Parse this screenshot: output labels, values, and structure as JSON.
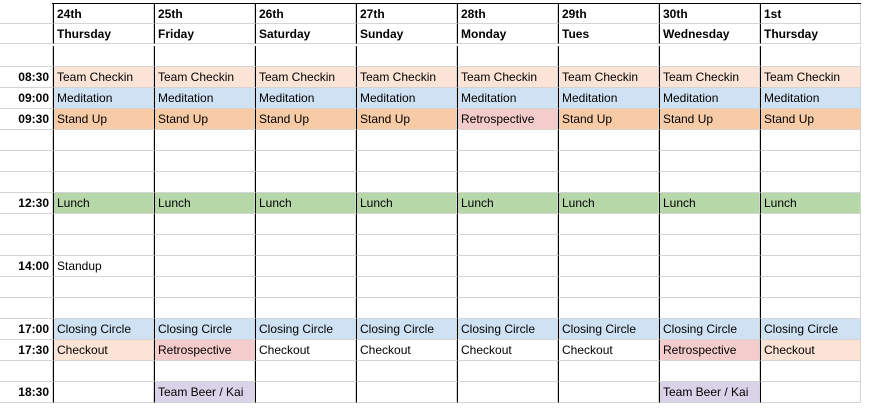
{
  "colors": {
    "peach": "#fbe4d5",
    "blue": "#cfe2f3",
    "orange": "#f8cba7",
    "pink": "#f4cccc",
    "green": "#b6d7a8",
    "lavender": "#d9d2e9",
    "white": "#ffffff"
  },
  "days": [
    {
      "date": "24th",
      "weekday": "Thursday"
    },
    {
      "date": "25th",
      "weekday": "Friday"
    },
    {
      "date": "26th",
      "weekday": "Saturday"
    },
    {
      "date": "27th",
      "weekday": "Sunday"
    },
    {
      "date": "28th",
      "weekday": "Monday"
    },
    {
      "date": "29th",
      "weekday": "Tues"
    },
    {
      "date": "30th",
      "weekday": "Wednesday"
    },
    {
      "date": "1st",
      "weekday": "Thursday"
    }
  ],
  "rows": [
    {
      "time": "",
      "cells": [],
      "spacer": true
    },
    {
      "time": "08:30",
      "cells": [
        {
          "text": "Team Checkin",
          "color": "peach"
        },
        {
          "text": "Team Checkin",
          "color": "peach"
        },
        {
          "text": "Team Checkin",
          "color": "peach"
        },
        {
          "text": "Team Checkin",
          "color": "peach"
        },
        {
          "text": "Team Checkin",
          "color": "peach"
        },
        {
          "text": "Team Checkin",
          "color": "peach"
        },
        {
          "text": "Team Checkin",
          "color": "peach"
        },
        {
          "text": "Team Checkin",
          "color": "peach"
        }
      ]
    },
    {
      "time": "09:00",
      "cells": [
        {
          "text": "Meditation",
          "color": "blue"
        },
        {
          "text": "Meditation",
          "color": "blue"
        },
        {
          "text": "Meditation",
          "color": "blue"
        },
        {
          "text": "Meditation",
          "color": "blue"
        },
        {
          "text": "Meditation",
          "color": "blue"
        },
        {
          "text": "Meditation",
          "color": "blue"
        },
        {
          "text": "Meditation",
          "color": "blue"
        },
        {
          "text": "Meditation",
          "color": "blue"
        }
      ]
    },
    {
      "time": "09:30",
      "cells": [
        {
          "text": "Stand Up",
          "color": "orange"
        },
        {
          "text": "Stand Up",
          "color": "orange"
        },
        {
          "text": "Stand Up",
          "color": "orange"
        },
        {
          "text": "Stand Up",
          "color": "orange"
        },
        {
          "text": "Retrospective",
          "color": "pink"
        },
        {
          "text": "Stand Up",
          "color": "orange"
        },
        {
          "text": "Stand Up",
          "color": "orange"
        },
        {
          "text": "Stand Up",
          "color": "orange"
        }
      ]
    },
    {
      "time": "",
      "cells": []
    },
    {
      "time": "",
      "cells": []
    },
    {
      "time": "",
      "cells": []
    },
    {
      "time": "12:30",
      "cells": [
        {
          "text": "Lunch",
          "color": "green"
        },
        {
          "text": "Lunch",
          "color": "green"
        },
        {
          "text": "Lunch",
          "color": "green"
        },
        {
          "text": "Lunch",
          "color": "green"
        },
        {
          "text": "Lunch",
          "color": "green"
        },
        {
          "text": "Lunch",
          "color": "green"
        },
        {
          "text": "Lunch",
          "color": "green"
        },
        {
          "text": "Lunch",
          "color": "green"
        }
      ]
    },
    {
      "time": "",
      "cells": []
    },
    {
      "time": "",
      "cells": []
    },
    {
      "time": "14:00",
      "cells": [
        {
          "text": "Standup",
          "color": "white"
        },
        {
          "text": "",
          "color": "white"
        },
        {
          "text": "",
          "color": "white"
        },
        {
          "text": "",
          "color": "white"
        },
        {
          "text": "",
          "color": "white"
        },
        {
          "text": "",
          "color": "white"
        },
        {
          "text": "",
          "color": "white"
        },
        {
          "text": "",
          "color": "white"
        }
      ]
    },
    {
      "time": "",
      "cells": []
    },
    {
      "time": "",
      "cells": []
    },
    {
      "time": "17:00",
      "cells": [
        {
          "text": "Closing Circle",
          "color": "blue"
        },
        {
          "text": "Closing Circle",
          "color": "blue"
        },
        {
          "text": "Closing Circle",
          "color": "blue"
        },
        {
          "text": "Closing Circle",
          "color": "blue"
        },
        {
          "text": "Closing Circle",
          "color": "blue"
        },
        {
          "text": "Closing Circle",
          "color": "blue"
        },
        {
          "text": "Closing Circle",
          "color": "blue"
        },
        {
          "text": "Closing Circle",
          "color": "blue"
        }
      ]
    },
    {
      "time": "17:30",
      "cells": [
        {
          "text": "Checkout",
          "color": "peach"
        },
        {
          "text": "Retrospective",
          "color": "pink"
        },
        {
          "text": "Checkout",
          "color": "white"
        },
        {
          "text": "Checkout",
          "color": "white"
        },
        {
          "text": "Checkout",
          "color": "white"
        },
        {
          "text": "Checkout",
          "color": "white"
        },
        {
          "text": "Retrospective",
          "color": "pink"
        },
        {
          "text": "Checkout",
          "color": "peach"
        }
      ]
    },
    {
      "time": "",
      "cells": []
    },
    {
      "time": "18:30",
      "cells": [
        {
          "text": "",
          "color": "white"
        },
        {
          "text": "Team Beer / Kai",
          "color": "lavender"
        },
        {
          "text": "",
          "color": "white"
        },
        {
          "text": "",
          "color": "white"
        },
        {
          "text": "",
          "color": "white"
        },
        {
          "text": "",
          "color": "white"
        },
        {
          "text": "Team Beer / Kai",
          "color": "lavender"
        },
        {
          "text": "",
          "color": "white"
        }
      ]
    }
  ]
}
